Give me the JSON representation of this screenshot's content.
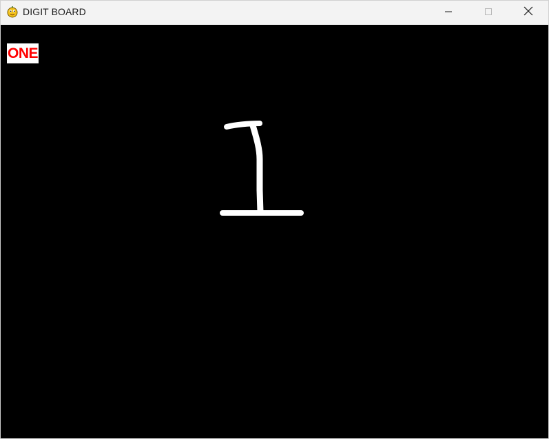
{
  "window": {
    "title": "DIGIT BOARD",
    "icon": "pygame-snake-icon",
    "controls": {
      "minimize_icon": "minimize-icon",
      "maximize_icon": "maximize-icon",
      "close_icon": "close-icon"
    }
  },
  "board": {
    "background_color": "#000000",
    "stroke_color": "#ffffff",
    "prediction_label": "ONE",
    "prediction_color": "#ff0000",
    "prediction_background": "#ffffff"
  }
}
